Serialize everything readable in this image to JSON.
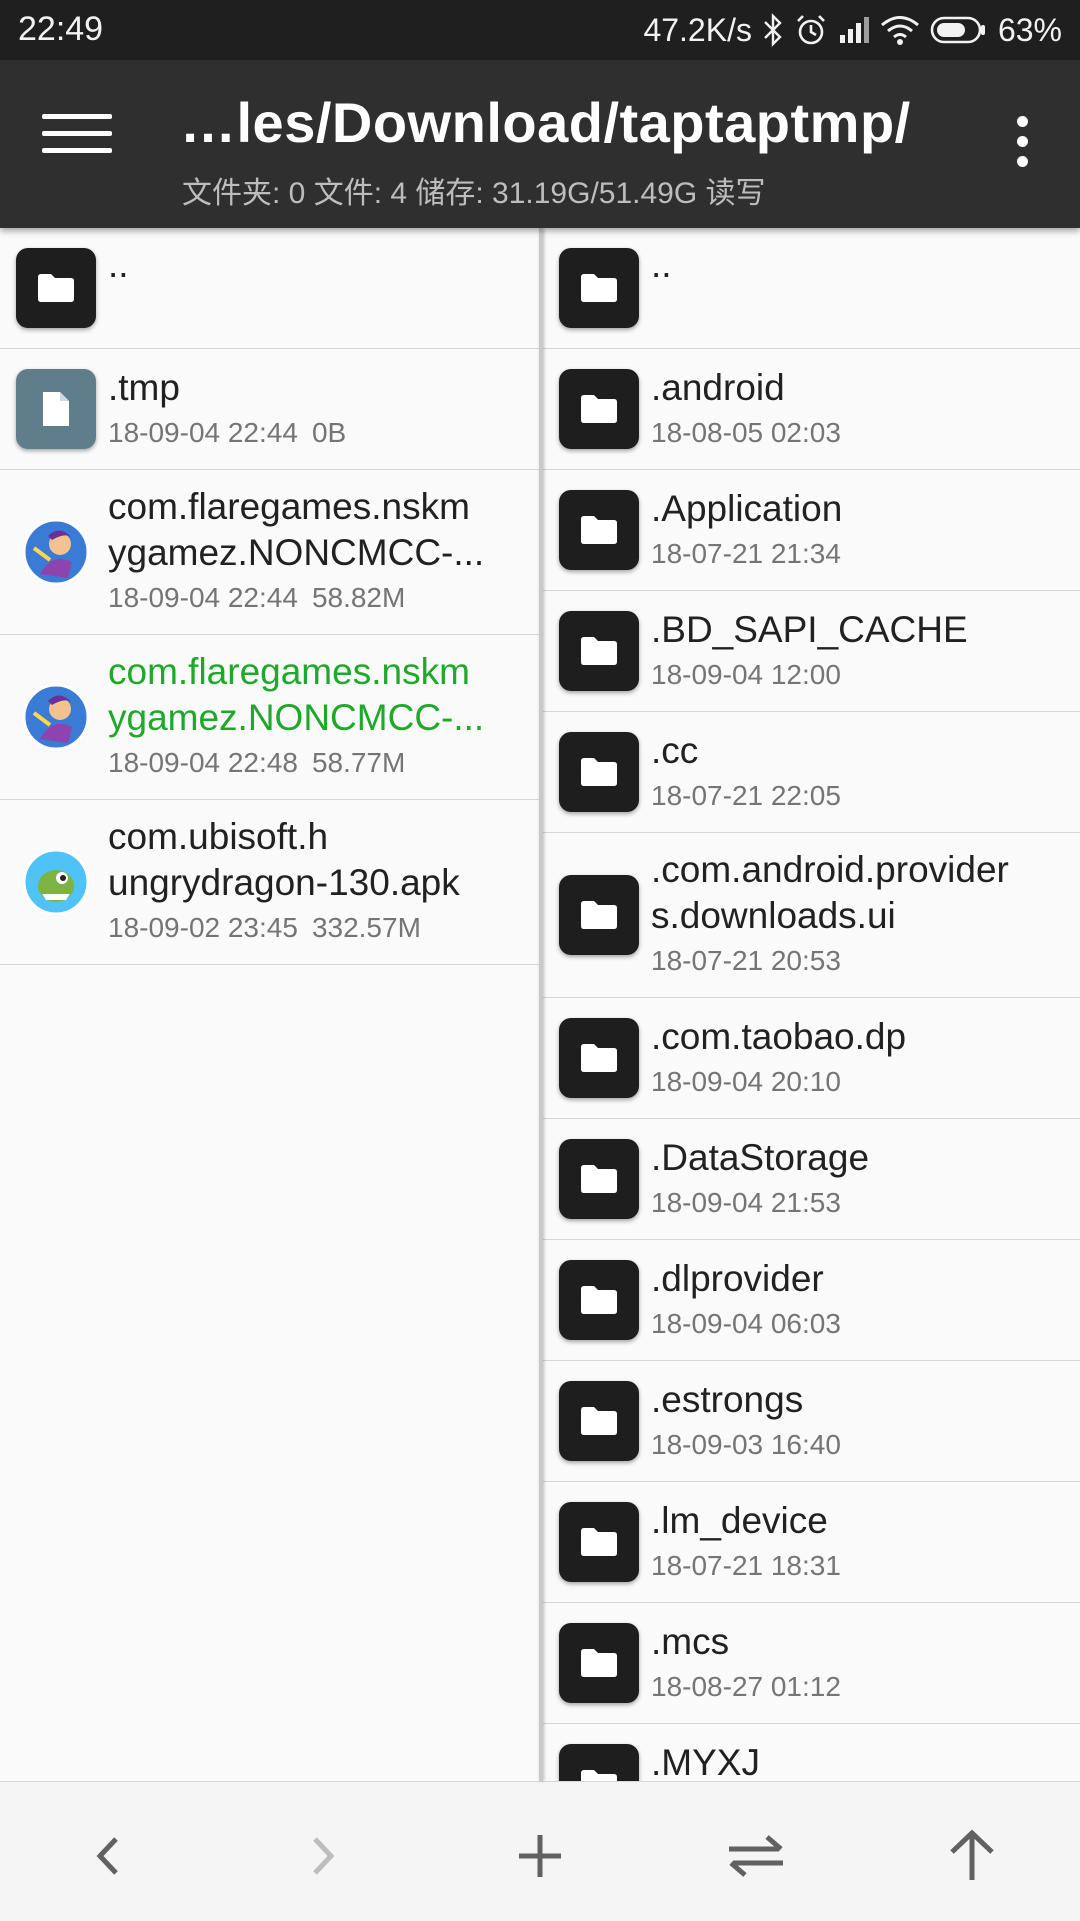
{
  "status_bar": {
    "time": "22:49",
    "net_speed": "47.2K/s",
    "battery": "63%",
    "icons": [
      "bluetooth-icon",
      "alarm-icon",
      "signal-icon",
      "wifi-icon",
      "battery-icon"
    ]
  },
  "app_bar": {
    "path": "…les/Download/taptaptmp/",
    "info": "文件夹: 0  文件: 4  储存: 31.19G/51.49G  读写"
  },
  "left_pane": {
    "items": [
      {
        "name": "..",
        "type": "folder"
      },
      {
        "name": ".tmp",
        "date": "18-09-04 22:44",
        "size": "0B",
        "type": "file"
      },
      {
        "name_line1": "com.flaregames.nskm",
        "name_line2": "ygamez.NONCMCC-...",
        "date": "18-09-04 22:44",
        "size": "58.82M",
        "type": "app"
      },
      {
        "name_line1": "com.flaregames.nskm",
        "name_line2": "ygamez.NONCMCC-...",
        "date": "18-09-04 22:48",
        "size": "58.77M",
        "type": "app",
        "highlight": "#1fa82a"
      },
      {
        "name_line1": "com.ubisoft.h",
        "name_line2": "ungrydragon-130.apk",
        "date": "18-09-02 23:45",
        "size": "332.57M",
        "type": "app"
      }
    ]
  },
  "right_pane": {
    "items": [
      {
        "name": ".."
      },
      {
        "name": ".android",
        "date": "18-08-05 02:03"
      },
      {
        "name": ".Application",
        "date": "18-07-21 21:34"
      },
      {
        "name": ".BD_SAPI_CACHE",
        "date": "18-09-04 12:00"
      },
      {
        "name": ".cc",
        "date": "18-07-21 22:05"
      },
      {
        "name_line1": ".com.android.provider",
        "name_line2": "s.downloads.ui",
        "date": "18-07-21 20:53"
      },
      {
        "name": ".com.taobao.dp",
        "date": "18-09-04 20:10"
      },
      {
        "name": ".DataStorage",
        "date": "18-09-04 21:53"
      },
      {
        "name": ".dlprovider",
        "date": "18-09-04 06:03"
      },
      {
        "name": ".estrongs",
        "date": "18-09-03 16:40"
      },
      {
        "name": ".lm_device",
        "date": "18-07-21 18:31"
      },
      {
        "name": ".mcs",
        "date": "18-08-27 01:12"
      },
      {
        "name": ".MYXJ"
      }
    ]
  },
  "bottom_bar": {
    "buttons": [
      "back-icon",
      "forward-icon",
      "add-icon",
      "swap-icon",
      "up-icon"
    ]
  },
  "colors": {
    "status_bar": "#1f1f1f",
    "app_bar": "#2f2f2f",
    "folder_icon": "#1e1e1e",
    "file_icon": "#607d8b",
    "highlight_green": "#1fa82a"
  }
}
